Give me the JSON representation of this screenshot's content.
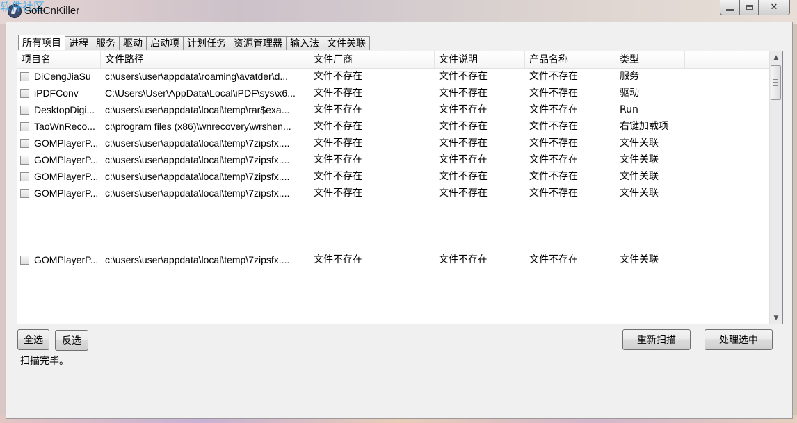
{
  "window": {
    "title": "SoftCnKiller",
    "watermark": "软件社区"
  },
  "tabs": [
    {
      "label": "所有项目",
      "active": true
    },
    {
      "label": "进程"
    },
    {
      "label": "服务"
    },
    {
      "label": "驱动"
    },
    {
      "label": "启动项"
    },
    {
      "label": "计划任务"
    },
    {
      "label": "资源管理器"
    },
    {
      "label": "输入法"
    },
    {
      "label": "文件关联"
    }
  ],
  "list": {
    "columns": [
      "项目名",
      "文件路径",
      "文件厂商",
      "文件说明",
      "产品名称",
      "类型"
    ],
    "rows": [
      {
        "name": "DiCengJiaSu",
        "path": "c:\\users\\user\\appdata\\roaming\\avatder\\d...",
        "vendor": "文件不存在",
        "desc": "文件不存在",
        "product": "文件不存在",
        "type": "服务",
        "checked": false
      },
      {
        "name": "iPDFConv",
        "path": "C:\\Users\\User\\AppData\\Local\\iPDF\\sys\\x6...",
        "vendor": "文件不存在",
        "desc": "文件不存在",
        "product": "文件不存在",
        "type": "驱动",
        "checked": false
      },
      {
        "name": "DesktopDigi...",
        "path": "c:\\users\\user\\appdata\\local\\temp\\rar$exa...",
        "vendor": "文件不存在",
        "desc": "文件不存在",
        "product": "文件不存在",
        "type": "Run",
        "checked": false
      },
      {
        "name": "TaoWnReco...",
        "path": "c:\\program files (x86)\\wnrecovery\\wrshen...",
        "vendor": "文件不存在",
        "desc": "文件不存在",
        "product": "文件不存在",
        "type": "右键加载项",
        "checked": false
      },
      {
        "name": "GOMPlayerP...",
        "path": "c:\\users\\user\\appdata\\local\\temp\\7zipsfx....",
        "vendor": "文件不存在",
        "desc": "文件不存在",
        "product": "文件不存在",
        "type": "文件关联",
        "checked": false
      },
      {
        "name": "GOMPlayerP...",
        "path": "c:\\users\\user\\appdata\\local\\temp\\7zipsfx....",
        "vendor": "文件不存在",
        "desc": "文件不存在",
        "product": "文件不存在",
        "type": "文件关联",
        "checked": false
      },
      {
        "name": "GOMPlayerP...",
        "path": "c:\\users\\user\\appdata\\local\\temp\\7zipsfx....",
        "vendor": "文件不存在",
        "desc": "文件不存在",
        "product": "文件不存在",
        "type": "文件关联",
        "checked": false
      },
      {
        "name": "GOMPlayerP...",
        "path": "c:\\users\\user\\appdata\\local\\temp\\7zipsfx....",
        "vendor": "文件不存在",
        "desc": "文件不存在",
        "product": "文件不存在",
        "type": "文件关联",
        "checked": false
      },
      {
        "name": "GOMPlayerP...",
        "path": "c:\\users\\user\\appdata\\local\\temp\\7zipsfx....",
        "vendor": "文件不存在",
        "desc": "文件不存在",
        "product": "文件不存在",
        "type": "文件关联",
        "checked": false
      }
    ]
  },
  "buttons": {
    "select_all": "全选",
    "invert": "反选",
    "rescan": "重新扫描",
    "process_selected": "处理选中"
  },
  "status": "扫描完毕。"
}
